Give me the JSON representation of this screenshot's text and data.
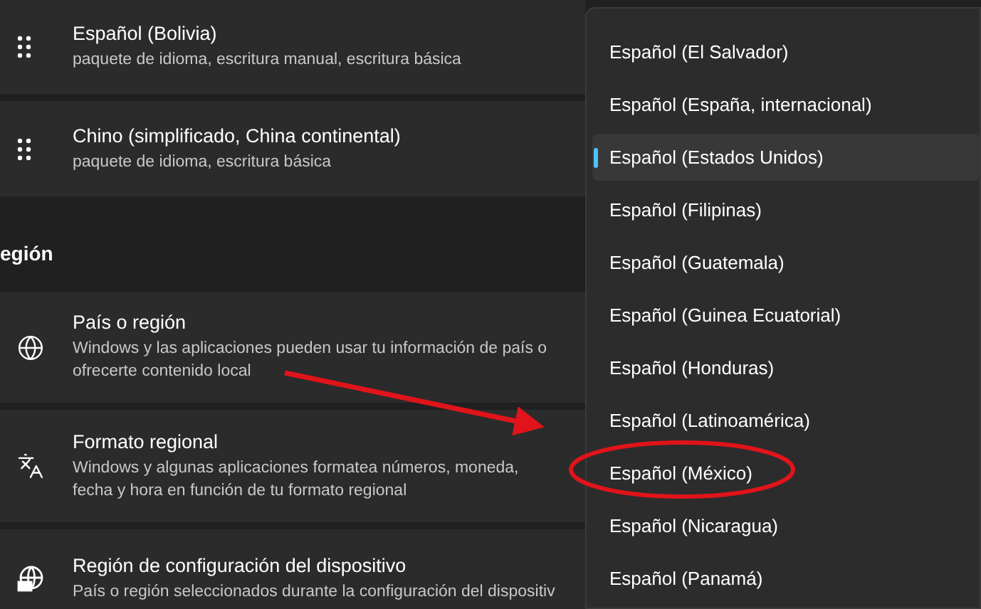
{
  "languages": [
    {
      "title": "Español (Bolivia)",
      "subtitle": "paquete de idioma, escritura manual, escritura básica"
    },
    {
      "title": "Chino (simplificado, China continental)",
      "subtitle": "paquete de idioma, escritura básica"
    }
  ],
  "section_heading": "egión",
  "settings": [
    {
      "kind": "globe",
      "title": "País o región",
      "description": "Windows y las aplicaciones pueden usar tu información de país o\nofrecerte contenido local"
    },
    {
      "kind": "language",
      "title": "Formato regional",
      "description": "Windows y algunas aplicaciones formatea números, moneda,\nfecha y hora en función de tu formato regional"
    },
    {
      "kind": "device",
      "title": "Región de configuración del dispositivo",
      "description": "País o región seleccionados durante la configuración del dispositiv"
    }
  ],
  "dropdown": {
    "options": [
      {
        "label": "Español (El Salvador)",
        "selected": false
      },
      {
        "label": "Español (España, internacional)",
        "selected": false
      },
      {
        "label": "Español (Estados Unidos)",
        "selected": true
      },
      {
        "label": "Español (Filipinas)",
        "selected": false
      },
      {
        "label": "Español (Guatemala)",
        "selected": false
      },
      {
        "label": "Español (Guinea Ecuatorial)",
        "selected": false
      },
      {
        "label": "Español (Honduras)",
        "selected": false
      },
      {
        "label": "Español (Latinoamérica)",
        "selected": false
      },
      {
        "label": "Español (México)",
        "selected": false
      },
      {
        "label": "Español (Nicaragua)",
        "selected": false
      },
      {
        "label": "Español (Panamá)",
        "selected": false
      }
    ]
  }
}
